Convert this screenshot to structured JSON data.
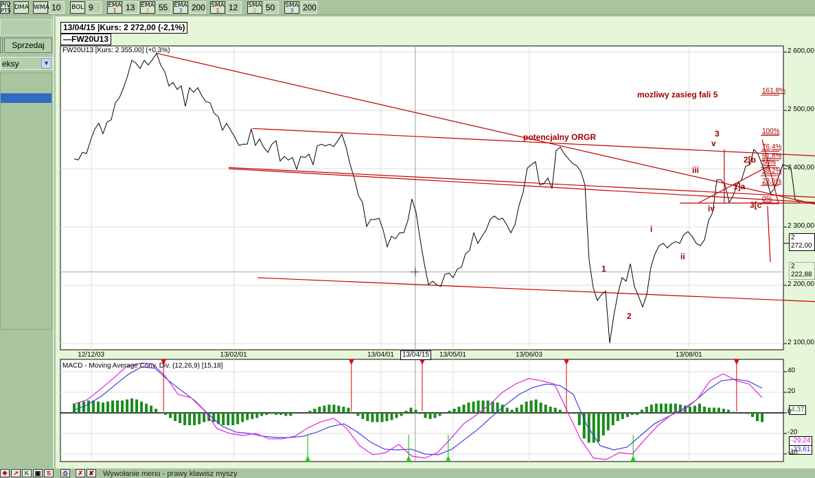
{
  "toolbar": {
    "items": [
      {
        "label": "PIV",
        "sub": "PTS"
      },
      {
        "label": "DMA"
      },
      {
        "label": "WMA",
        "value": "10"
      },
      {
        "label": "BOL",
        "value": "9"
      },
      {
        "label": "EMA",
        "sub": "1",
        "value": "13"
      },
      {
        "label": "EMA",
        "sub": "2",
        "value": "55"
      },
      {
        "label": "EMA",
        "sub": "3",
        "value": "200"
      },
      {
        "label": "SMA",
        "sub": "1",
        "value": "12"
      },
      {
        "label": "SMA",
        "sub": "2",
        "value": "50"
      },
      {
        "label": "SMA",
        "sub": "3",
        "value": "200"
      }
    ]
  },
  "left": {
    "sell_label": "Sprzedaj",
    "select_value": "eksy"
  },
  "chart": {
    "date_header": "13/04/15 |Kurs: 2 272,00 (-2,1%)",
    "legend": "FW20U13",
    "subtitle": "FW20U13 [Kurs: 2 355,00] (+0,3%)",
    "colors": {
      "price": "#000000",
      "trend": "#c00000",
      "annotation": "#a00000",
      "macd": "#e020e0",
      "signal": "#4040e0",
      "hist": "#1a8c1a"
    },
    "current_price_label": "2 272,00",
    "crosshair_price_label": "2 222,88",
    "crosshair_date_label": "13/04/15",
    "crosshair_day": 82.8,
    "crosshair_price": 2222.88,
    "annotations": {
      "target": "mozliwy zasieg fali 5",
      "orgr": "potencjalny ORGR",
      "w3": "3",
      "wv": "v",
      "wiii": "iii",
      "wiv": "iv",
      "w2b": "2[b",
      "w1a": "1]a",
      "w3c": "3[c",
      "wi": "i",
      "wii": "ii",
      "w1": "1",
      "w2": "2"
    },
    "fib": [
      {
        "label": "161,8%",
        "price": 2526
      },
      {
        "label": "100%",
        "price": 2457
      },
      {
        "label": "76,4%",
        "price": 2430
      },
      {
        "label": "61,8%",
        "price": 2414
      },
      {
        "label": "50%",
        "price": 2402
      },
      {
        "label": "38,2%",
        "price": 2388
      },
      {
        "label": "23,6%",
        "price": 2371
      },
      {
        "label": "0%",
        "price": 2340
      }
    ]
  },
  "chart_data": [
    {
      "type": "line",
      "title": "FW20U13",
      "ylim": [
        2090,
        2615
      ],
      "yticks": [
        {
          "v": 2600,
          "label": "2 600,00"
        },
        {
          "v": 2500,
          "label": "2 500,00"
        },
        {
          "v": 2400,
          "label": "2 400,00"
        },
        {
          "v": 2300,
          "label": "2 300,00"
        },
        {
          "v": 2200,
          "label": "2 200,00"
        },
        {
          "v": 2100,
          "label": "2 100,00"
        }
      ],
      "xticks": [
        {
          "day": 4.2,
          "label": "12/12/03"
        },
        {
          "day": 38.8,
          "label": "13/02/01"
        },
        {
          "day": 74.5,
          "label": "13/04/01"
        },
        {
          "day": 92,
          "label": "13/05/01"
        },
        {
          "day": 110.5,
          "label": "13/06/03"
        },
        {
          "day": 149.3,
          "label": "13/08/01"
        }
      ],
      "close": [
        2417,
        2415,
        2428,
        2426,
        2449,
        2468,
        2478,
        2460,
        2480,
        2484,
        2513,
        2522,
        2539,
        2560,
        2586,
        2581,
        2572,
        2586,
        2578,
        2587,
        2598,
        2578,
        2566,
        2542,
        2548,
        2536,
        2542,
        2507,
        2539,
        2531,
        2539,
        2525,
        2515,
        2513,
        2495,
        2489,
        2466,
        2478,
        2466,
        2454,
        2440,
        2442,
        2442,
        2468,
        2440,
        2451,
        2437,
        2428,
        2442,
        2448,
        2413,
        2421,
        2415,
        2419,
        2399,
        2421,
        2419,
        2425,
        2407,
        2439,
        2442,
        2439,
        2442,
        2438,
        2448,
        2459,
        2437,
        2407,
        2384,
        2354,
        2342,
        2301,
        2313,
        2313,
        2315,
        2295,
        2266,
        2284,
        2280,
        2290,
        2290,
        2311,
        2348,
        2325,
        2278,
        2237,
        2201,
        2207,
        2201,
        2198,
        2219,
        2221,
        2213,
        2228,
        2231,
        2254,
        2260,
        2290,
        2272,
        2284,
        2295,
        2313,
        2319,
        2313,
        2315,
        2304,
        2290,
        2304,
        2337,
        2360,
        2401,
        2407,
        2412,
        2372,
        2374,
        2384,
        2366,
        2431,
        2437,
        2425,
        2417,
        2409,
        2405,
        2395,
        2372,
        2243,
        2196,
        2174,
        2184,
        2190,
        2101,
        2148,
        2186,
        2213,
        2207,
        2237,
        2198,
        2181,
        2163,
        2184,
        2231,
        2254,
        2268,
        2272,
        2264,
        2271,
        2275,
        2272,
        2287,
        2292,
        2284,
        2272,
        2268,
        2278,
        2311,
        2325,
        2381,
        2381,
        2372,
        2342,
        2354,
        2374,
        2381,
        2404,
        2407,
        2433,
        2425,
        2407,
        2384,
        2358,
        2366,
        2386,
        2407,
        2405,
        2401,
        2348,
        2342
      ],
      "trendlines": [
        [
          20,
          2598,
          180,
          2339
        ],
        [
          43.3,
          2469,
          180,
          2422
        ],
        [
          37.5,
          2402,
          180,
          2351
        ],
        [
          37.5,
          2400,
          180,
          2342
        ],
        [
          44.5,
          2213,
          180,
          2172
        ],
        [
          147,
          2341,
          180,
          2341
        ],
        [
          151.5,
          2341,
          169,
          2406
        ],
        [
          157.8,
          2433,
          157.8,
          2341
        ],
        [
          168.3,
          2336,
          169,
          2240
        ],
        [
          167,
          2450,
          171,
          2340
        ]
      ]
    },
    {
      "type": "line",
      "title": "MACD - Moving Average Conv. Div. (12,26,9) [15,18]",
      "ylim": [
        -48,
        50
      ],
      "yticks": [
        {
          "v": 40,
          "label": "40"
        },
        {
          "v": 20,
          "label": "20"
        },
        {
          "v": 0,
          "label": "0"
        },
        {
          "v": -20,
          "label": "-20"
        },
        {
          "v": -40,
          "label": "-40"
        }
      ],
      "last_values": {
        "hist": "4,37",
        "macd": "-29,24",
        "signal": "-33,61"
      },
      "macd": [
        8.7,
        12.7,
        22.7,
        33.3,
        44.7,
        48,
        48,
        36,
        18,
        14.7,
        2.7,
        -15.3,
        -20,
        -22,
        -20,
        -25.3,
        -25.3,
        -22.7,
        -14.7,
        -8.7,
        -5.3,
        -15.3,
        -32,
        -40.7,
        -38.7,
        -30.7,
        -42,
        -44,
        -38.7,
        -25.3,
        -10.7,
        -2,
        8,
        20,
        28,
        33.3,
        31.3,
        28,
        1.3,
        -25.3,
        -44,
        -45.3,
        -38.7,
        -40,
        -25.3,
        -12,
        -2,
        2.7,
        13.3,
        31.3,
        38,
        31.3,
        28,
        14.7
      ],
      "signal": [
        2.7,
        8,
        16,
        26.7,
        37.3,
        44.7,
        43.3,
        31.3,
        21.3,
        11.3,
        -2,
        -13.3,
        -18.7,
        -20,
        -22.7,
        -24,
        -24,
        -22.7,
        -18.7,
        -13.3,
        -10.7,
        -18.7,
        -28.7,
        -35.3,
        -36,
        -35.3,
        -40,
        -40.7,
        -35.3,
        -25.3,
        -15.3,
        -3.3,
        8,
        18,
        24.7,
        28,
        26.7,
        18,
        -12,
        -32,
        -36,
        -33.3,
        -22,
        -10.7,
        -4,
        2.7,
        11.3,
        22.7,
        31.3,
        32.7,
        30.7,
        24
      ],
      "hist": [
        9,
        10,
        11,
        12,
        12,
        11,
        10,
        11,
        12,
        12,
        12,
        13,
        14,
        13,
        11,
        9,
        7,
        4,
        0,
        -2,
        -5,
        -8,
        -10,
        -12,
        -12,
        -12,
        -11,
        -9,
        -8,
        -9,
        -11,
        -12,
        -12,
        -12,
        -11,
        -9,
        -7,
        -6,
        -5,
        -3,
        -2,
        -1,
        -2,
        -2,
        -3,
        -3,
        0,
        0,
        0,
        2,
        4,
        6,
        7,
        8,
        8,
        7,
        6,
        5,
        0,
        -3,
        -6,
        -8,
        -9,
        -9,
        -9,
        -8,
        -7,
        -5,
        -3,
        2,
        5,
        3,
        -1,
        -5,
        -6,
        -5,
        -3,
        0,
        2,
        4,
        6,
        8,
        10,
        11,
        12,
        12,
        12,
        11,
        10,
        8,
        5,
        3,
        5,
        8,
        11,
        12,
        13,
        10,
        8,
        6,
        5,
        3,
        1,
        0,
        -1,
        -12,
        -25,
        -29,
        -29,
        -28,
        -22,
        -17,
        -12,
        -8,
        -6,
        -4,
        -2,
        -2,
        3,
        6,
        8,
        9,
        9,
        9,
        9,
        9,
        8,
        7,
        6,
        7,
        9,
        6,
        5,
        5,
        5,
        4,
        3,
        1,
        0,
        0,
        -1,
        -4,
        -8,
        -9
      ],
      "sell_signals_day": [
        21.7,
        67.3,
        84.5,
        119.5,
        160.8
      ],
      "buy_signals_day": [
        56.7,
        81.2,
        90.8,
        135.7
      ]
    }
  ],
  "status": {
    "text": "Wywołanie menu - prawy klawisz myszy"
  }
}
